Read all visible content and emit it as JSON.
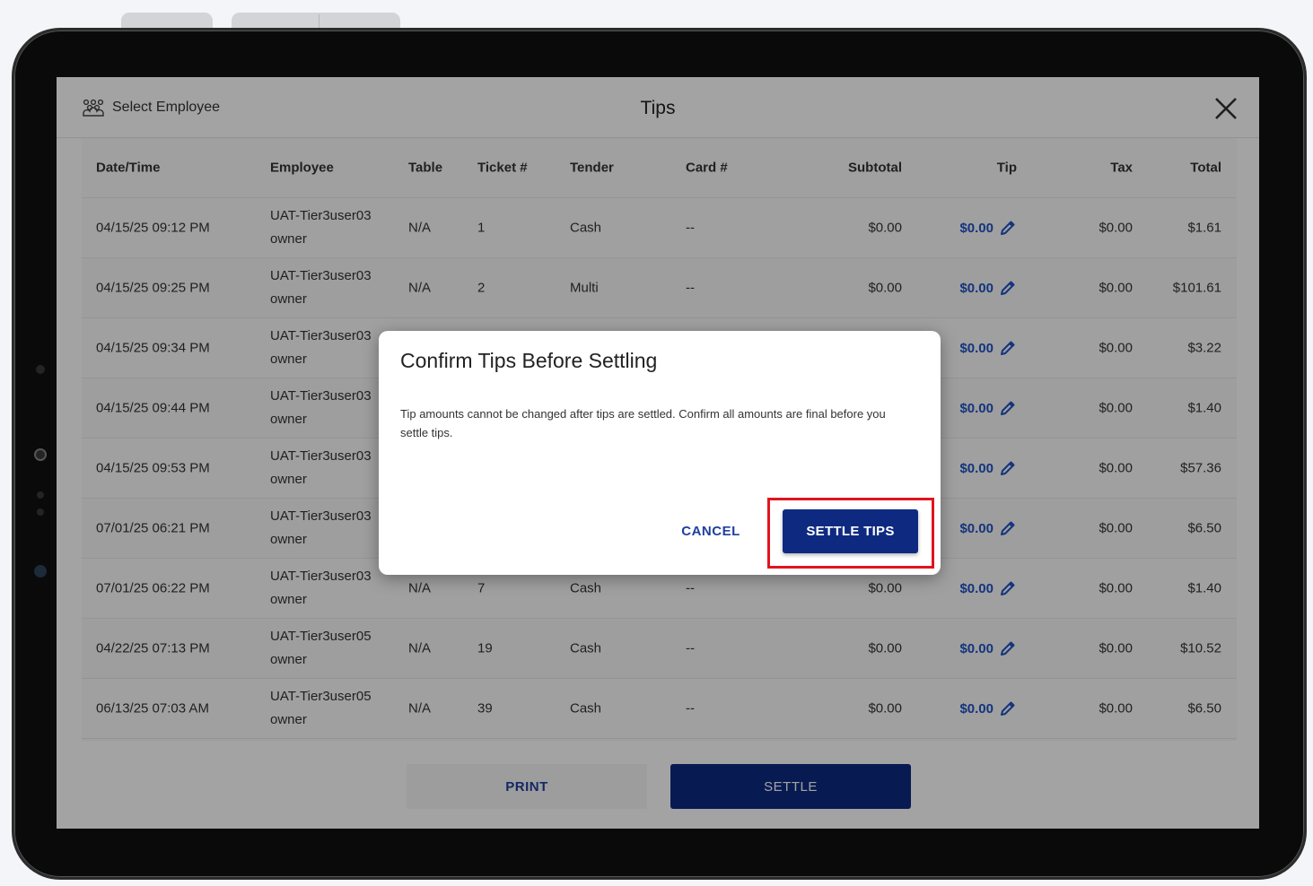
{
  "header": {
    "select_employee_label": "Select Employee",
    "title": "Tips"
  },
  "table": {
    "columns": [
      "Date/Time",
      "Employee",
      "Table",
      "Ticket #",
      "Tender",
      "Card #",
      "Subtotal",
      "Tip",
      "Tax",
      "Total"
    ],
    "rows": [
      {
        "datetime": "04/15/25 09:12 PM",
        "employee": "UAT-Tier3user03",
        "role": "owner",
        "table": "N/A",
        "ticket": "1",
        "tender": "Cash",
        "card": "--",
        "subtotal": "$0.00",
        "tip": "$0.00",
        "tax": "$0.00",
        "total": "$1.61"
      },
      {
        "datetime": "04/15/25 09:25 PM",
        "employee": "UAT-Tier3user03",
        "role": "owner",
        "table": "N/A",
        "ticket": "2",
        "tender": "Multi",
        "card": "--",
        "subtotal": "$0.00",
        "tip": "$0.00",
        "tax": "$0.00",
        "total": "$101.61"
      },
      {
        "datetime": "04/15/25 09:34 PM",
        "employee": "UAT-Tier3user03",
        "role": "owner",
        "table": "",
        "ticket": "",
        "tender": "",
        "card": "",
        "subtotal": "",
        "tip": "$0.00",
        "tax": "$0.00",
        "total": "$3.22"
      },
      {
        "datetime": "04/15/25 09:44 PM",
        "employee": "UAT-Tier3user03",
        "role": "owner",
        "table": "",
        "ticket": "",
        "tender": "",
        "card": "",
        "subtotal": "",
        "tip": "$0.00",
        "tax": "$0.00",
        "total": "$1.40"
      },
      {
        "datetime": "04/15/25 09:53 PM",
        "employee": "UAT-Tier3user03",
        "role": "owner",
        "table": "",
        "ticket": "",
        "tender": "",
        "card": "",
        "subtotal": "",
        "tip": "$0.00",
        "tax": "$0.00",
        "total": "$57.36"
      },
      {
        "datetime": "07/01/25 06:21 PM",
        "employee": "UAT-Tier3user03",
        "role": "owner",
        "table": "",
        "ticket": "",
        "tender": "",
        "card": "",
        "subtotal": "",
        "tip": "$0.00",
        "tax": "$0.00",
        "total": "$6.50"
      },
      {
        "datetime": "07/01/25 06:22 PM",
        "employee": "UAT-Tier3user03",
        "role": "owner",
        "table": "N/A",
        "ticket": "7",
        "tender": "Cash",
        "card": "--",
        "subtotal": "$0.00",
        "tip": "$0.00",
        "tax": "$0.00",
        "total": "$1.40"
      },
      {
        "datetime": "04/22/25 07:13 PM",
        "employee": "UAT-Tier3user05",
        "role": "owner",
        "table": "N/A",
        "ticket": "19",
        "tender": "Cash",
        "card": "--",
        "subtotal": "$0.00",
        "tip": "$0.00",
        "tax": "$0.00",
        "total": "$10.52"
      },
      {
        "datetime": "06/13/25 07:03 AM",
        "employee": "UAT-Tier3user05",
        "role": "owner",
        "table": "N/A",
        "ticket": "39",
        "tender": "Cash",
        "card": "--",
        "subtotal": "$0.00",
        "tip": "$0.00",
        "tax": "$0.00",
        "total": "$6.50"
      }
    ]
  },
  "footer": {
    "print_label": "PRINT",
    "settle_label": "SETTLE"
  },
  "dialog": {
    "title": "Confirm Tips Before Settling",
    "body": "Tip amounts cannot be changed after tips are settled. Confirm all amounts are final before you settle tips.",
    "cancel_label": "CANCEL",
    "confirm_label": "SETTLE TIPS"
  },
  "colors": {
    "primary": "#0e2a80",
    "link": "#1f52c4",
    "highlight": "#e0141e"
  }
}
